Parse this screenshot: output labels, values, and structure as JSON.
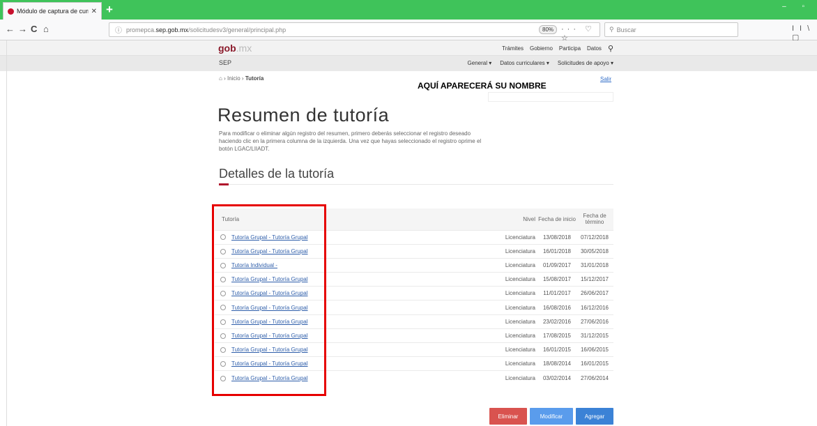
{
  "browser": {
    "tab_title": "Módulo de captura de curricul",
    "tab_close": "✕",
    "new_tab": "+",
    "window_controls": "– ▫",
    "back": "←",
    "forward": "→",
    "reload": "C",
    "home": "⌂",
    "url_prefix": "promepca.",
    "url_host": "sep.gob.mx",
    "url_path": "/solicitudesv3/general/principal.php",
    "zoom": "80%",
    "url_actions": "··· ♡ ☆",
    "search_placeholder": "Buscar",
    "library": "II\\ ▢"
  },
  "site": {
    "logo_gob": "gob",
    "logo_mx": ".mx",
    "topnav": [
      "Trámites",
      "Gobierno",
      "Participa",
      "Datos"
    ],
    "sep": "SEP",
    "subnav": [
      "General ▾",
      "Datos curriculares ▾",
      "Solicitudes de apoyo ▾"
    ],
    "breadcrumb_home": "⌂",
    "breadcrumb_sep1": "›",
    "breadcrumb_inicio": "Inicio",
    "breadcrumb_sep2": "›",
    "breadcrumb_current": "Tutoría",
    "user_name": "AQUÍ APARECERÁ SU NOMBRE",
    "logout": "Salir"
  },
  "main": {
    "title": "Resumen de tutoría",
    "intro": "Para modificar o eliminar algún registro del resumen, primero deberás seleccionar el registro deseado haciendo clic en la primera columna de la izquierda. Una vez que hayas seleccionado el registro oprime el botón LGAC/LIIADT.",
    "subtitle": "Detalles de la tutoría",
    "table": {
      "headers": {
        "tutoria": "Tutoría",
        "nivel": "Nivel",
        "inicio": "Fecha de inicio",
        "termino": "Fecha de término"
      },
      "rows": [
        {
          "tutoria": "Tutoría Grupal - Tutoría Grupal",
          "nivel": "Licenciatura",
          "inicio": "13/08/2018",
          "termino": "07/12/2018"
        },
        {
          "tutoria": "Tutoría Grupal - Tutoría Grupal",
          "nivel": "Licenciatura",
          "inicio": "16/01/2018",
          "termino": "30/05/2018"
        },
        {
          "tutoria": "Tutoría Individual -",
          "nivel": "Licenciatura",
          "inicio": "01/09/2017",
          "termino": "31/01/2018"
        },
        {
          "tutoria": "Tutoría Grupal - Tutoría Grupal",
          "nivel": "Licenciatura",
          "inicio": "15/08/2017",
          "termino": "15/12/2017"
        },
        {
          "tutoria": "Tutoría Grupal - Tutoría Grupal",
          "nivel": "Licenciatura",
          "inicio": "11/01/2017",
          "termino": "26/06/2017"
        },
        {
          "tutoria": "Tutoría Grupal - Tutoría Grupal",
          "nivel": "Licenciatura",
          "inicio": "16/08/2016",
          "termino": "16/12/2016"
        },
        {
          "tutoria": "Tutoría Grupal - Tutoría Grupal",
          "nivel": "Licenciatura",
          "inicio": "23/02/2016",
          "termino": "27/06/2016"
        },
        {
          "tutoria": "Tutoría Grupal - Tutoría Grupal",
          "nivel": "Licenciatura",
          "inicio": "17/08/2015",
          "termino": "31/12/2015"
        },
        {
          "tutoria": "Tutoría Grupal - Tutoría Grupal",
          "nivel": "Licenciatura",
          "inicio": "16/01/2015",
          "termino": "16/06/2015"
        },
        {
          "tutoria": "Tutoría Grupal - Tutoría Grupal",
          "nivel": "Licenciatura",
          "inicio": "18/08/2014",
          "termino": "16/01/2015"
        },
        {
          "tutoria": "Tutoría Grupal - Tutoría Grupal",
          "nivel": "Licenciatura",
          "inicio": "03/02/2014",
          "termino": "27/06/2014"
        }
      ]
    },
    "buttons": {
      "eliminar": "Eliminar",
      "modificar": "Modificar",
      "agregar": "Agregar"
    }
  },
  "colors": {
    "chrome_green": "#3fc35a",
    "brand": "#8b1a2b",
    "accent": "#b0132b",
    "link": "#2e5eaa",
    "highlight_box": "#e60000",
    "btn_delete": "#d9534f",
    "btn_modify": "#5a9cec",
    "btn_add": "#3b82d6"
  }
}
